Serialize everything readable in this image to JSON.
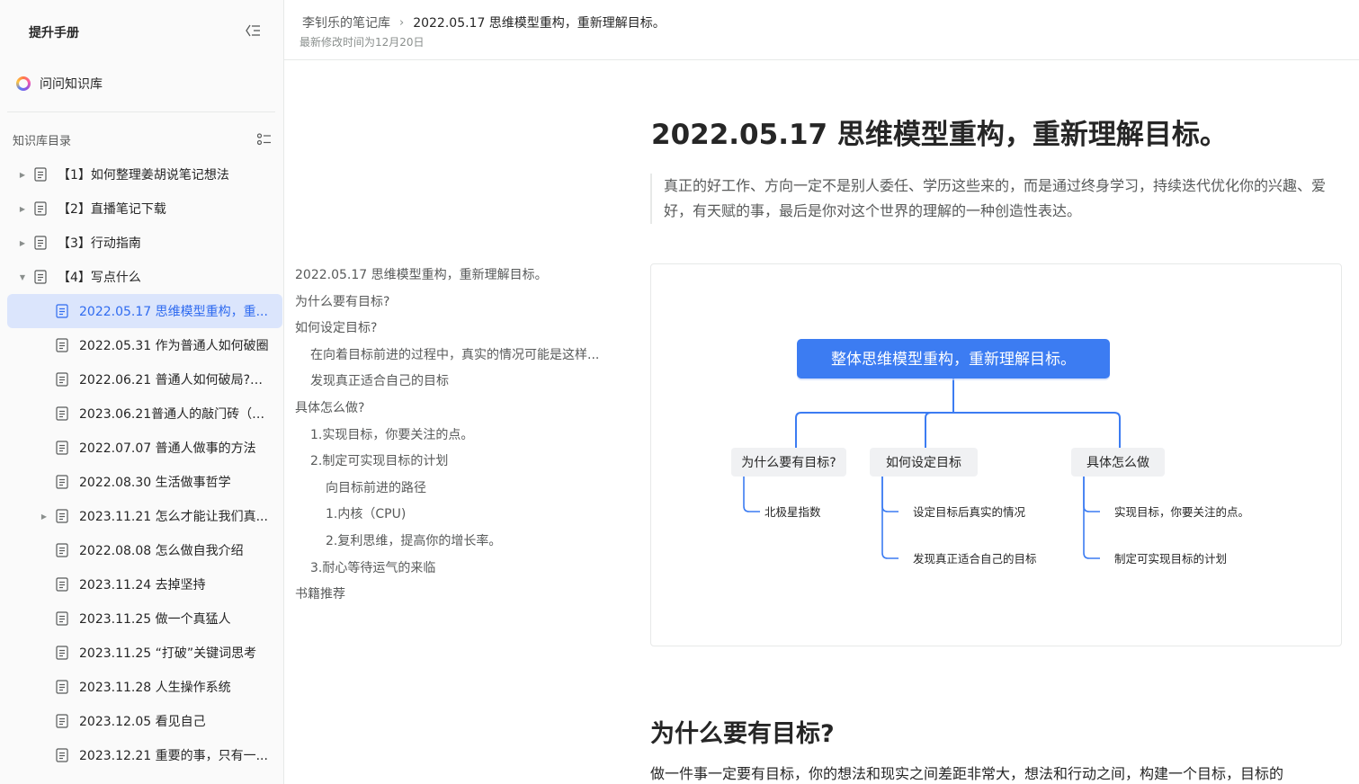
{
  "sidebar": {
    "title": "提升手册",
    "ask_label": "问问知识库",
    "toc_title": "知识库目录",
    "items": [
      {
        "label": "【1】如何整理姜胡说笔记想法",
        "level": 0,
        "caret": "right",
        "active": false
      },
      {
        "label": "【2】直播笔记下载",
        "level": 0,
        "caret": "right",
        "active": false
      },
      {
        "label": "【3】行动指南",
        "level": 0,
        "caret": "right",
        "active": false
      },
      {
        "label": "【4】写点什么",
        "level": 0,
        "caret": "down",
        "active": false
      },
      {
        "label": "2022.05.17 思维模型重构，重...",
        "level": 1,
        "caret": "",
        "active": true
      },
      {
        "label": "2022.05.31 作为普通人如何破圈",
        "level": 1,
        "caret": "",
        "active": false
      },
      {
        "label": "2022.06.21 普通人如何破局?（...",
        "level": 1,
        "caret": "",
        "active": false
      },
      {
        "label": "2023.06.21普通人的敲门砖（内...",
        "level": 1,
        "caret": "",
        "active": false
      },
      {
        "label": "2022.07.07 普通人做事的方法",
        "level": 1,
        "caret": "",
        "active": false
      },
      {
        "label": "2022.08.30 生活做事哲学",
        "level": 1,
        "caret": "",
        "active": false
      },
      {
        "label": "2023.11.21 怎么才能让我们真...",
        "level": 1,
        "caret": "right",
        "active": false
      },
      {
        "label": "2022.08.08 怎么做自我介绍",
        "level": 1,
        "caret": "",
        "active": false
      },
      {
        "label": "2023.11.24 去掉坚持",
        "level": 1,
        "caret": "",
        "active": false
      },
      {
        "label": "2023.11.25 做一个真猛人",
        "level": 1,
        "caret": "",
        "active": false
      },
      {
        "label": "2023.11.25 “打破”关键词思考",
        "level": 1,
        "caret": "",
        "active": false
      },
      {
        "label": "2023.11.28 人生操作系统",
        "level": 1,
        "caret": "",
        "active": false
      },
      {
        "label": "2023.12.05 看见自己",
        "level": 1,
        "caret": "",
        "active": false
      },
      {
        "label": "2023.12.21 重要的事，只有一...",
        "level": 1,
        "caret": "",
        "active": false
      }
    ]
  },
  "header": {
    "breadcrumb_root": "李钊乐的笔记库",
    "breadcrumb_separator": "›",
    "breadcrumb_current": "2022.05.17 思维模型重构，重新理解目标。",
    "last_modified": "最新修改时间为12月20日"
  },
  "outline": [
    {
      "text": "2022.05.17 思维模型重构，重新理解目标。",
      "level": 1
    },
    {
      "text": "为什么要有目标?",
      "level": 1
    },
    {
      "text": "如何设定目标?",
      "level": 1
    },
    {
      "text": "在向着目标前进的过程中，真实的情况可能是这样...",
      "level": 2
    },
    {
      "text": "发现真正适合自己的目标",
      "level": 2
    },
    {
      "text": "具体怎么做?",
      "level": 1
    },
    {
      "text": "1.实现目标，你要关注的点。",
      "level": 2
    },
    {
      "text": "2.制定可实现目标的计划",
      "level": 2
    },
    {
      "text": "向目标前进的路径",
      "level": 3
    },
    {
      "text": "1.内核（CPU)",
      "level": 3
    },
    {
      "text": "2.复利思维，提高你的增长率。",
      "level": 3
    },
    {
      "text": "3.耐心等待运气的来临",
      "level": 2
    },
    {
      "text": "书籍推荐",
      "level": 1
    }
  ],
  "document": {
    "title": "2022.05.17 思维模型重构，重新理解目标。",
    "quote": "真正的好工作、方向一定不是别人委任、学历这些来的，而是通过终身学习，持续迭代优化你的兴趣、爱好，有天赋的事，最后是你对这个世界的理解的一种创造性表达。",
    "section_heading": "为什么要有目标?",
    "section_paragraph": "做一件事一定要有目标，你的想法和现实之间差距非常大，想法和行动之间，构建一个目标，目标的"
  },
  "mindmap": {
    "root": "整体思维模型重构，重新理解目标。",
    "branches": [
      {
        "label": "为什么要有目标?",
        "children": [
          "北极星指数"
        ]
      },
      {
        "label": "如何设定目标",
        "children": [
          "设定目标后真实的情况",
          "发现真正适合自己的目标"
        ]
      },
      {
        "label": "具体怎么做",
        "children": [
          "实现目标，你要关注的点。",
          "制定可实现目标的计划"
        ]
      }
    ]
  },
  "colors": {
    "accent": "#2f6bf0",
    "mindmap_root": "#3c7cf2",
    "mindmap_line": "#3c7cf2",
    "active_item_bg": "#dbe5fc"
  }
}
